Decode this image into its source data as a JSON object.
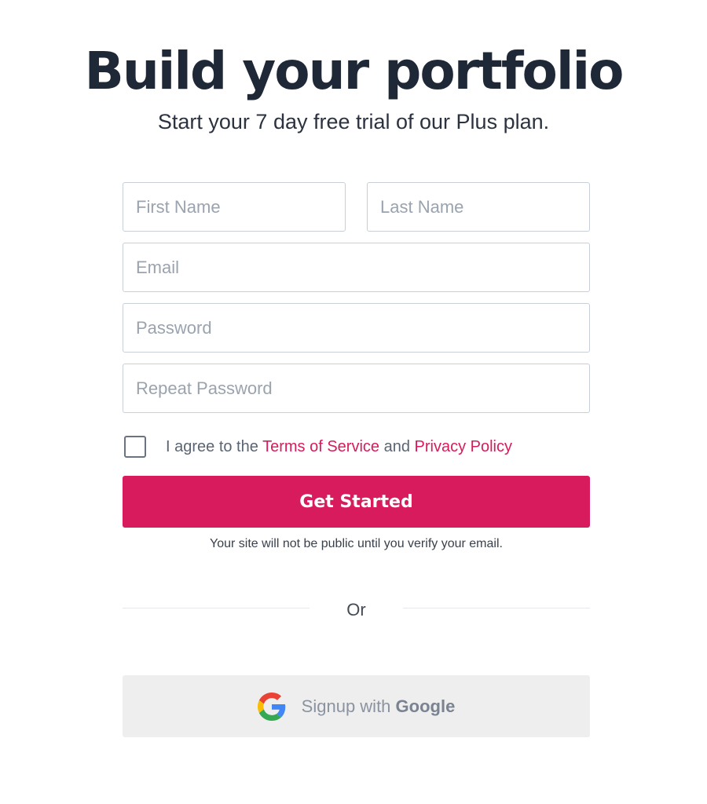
{
  "header": {
    "title": "Build your portfolio",
    "subtitle": "Start your 7 day free trial of our Plus plan."
  },
  "form": {
    "first_name": {
      "placeholder": "First Name",
      "value": ""
    },
    "last_name": {
      "placeholder": "Last Name",
      "value": ""
    },
    "email": {
      "placeholder": "Email",
      "value": ""
    },
    "password": {
      "placeholder": "Password",
      "value": ""
    },
    "repeat_password": {
      "placeholder": "Repeat Password",
      "value": ""
    },
    "agree": {
      "checked": false,
      "prefix": "I agree to the",
      "terms_link": "Terms of Service",
      "conjunction": "and",
      "privacy_link": "Privacy Policy"
    },
    "submit_label": "Get Started",
    "verify_note": "Your site will not be public until you verify your email."
  },
  "divider": {
    "label": "Or"
  },
  "social": {
    "google_prefix": "Signup with",
    "google_brand": "Google",
    "icon": "google-icon"
  },
  "colors": {
    "accent": "#d81b5c",
    "title": "#1f2837",
    "link": "#d81b5a",
    "google_button_bg": "#eeeeef"
  }
}
